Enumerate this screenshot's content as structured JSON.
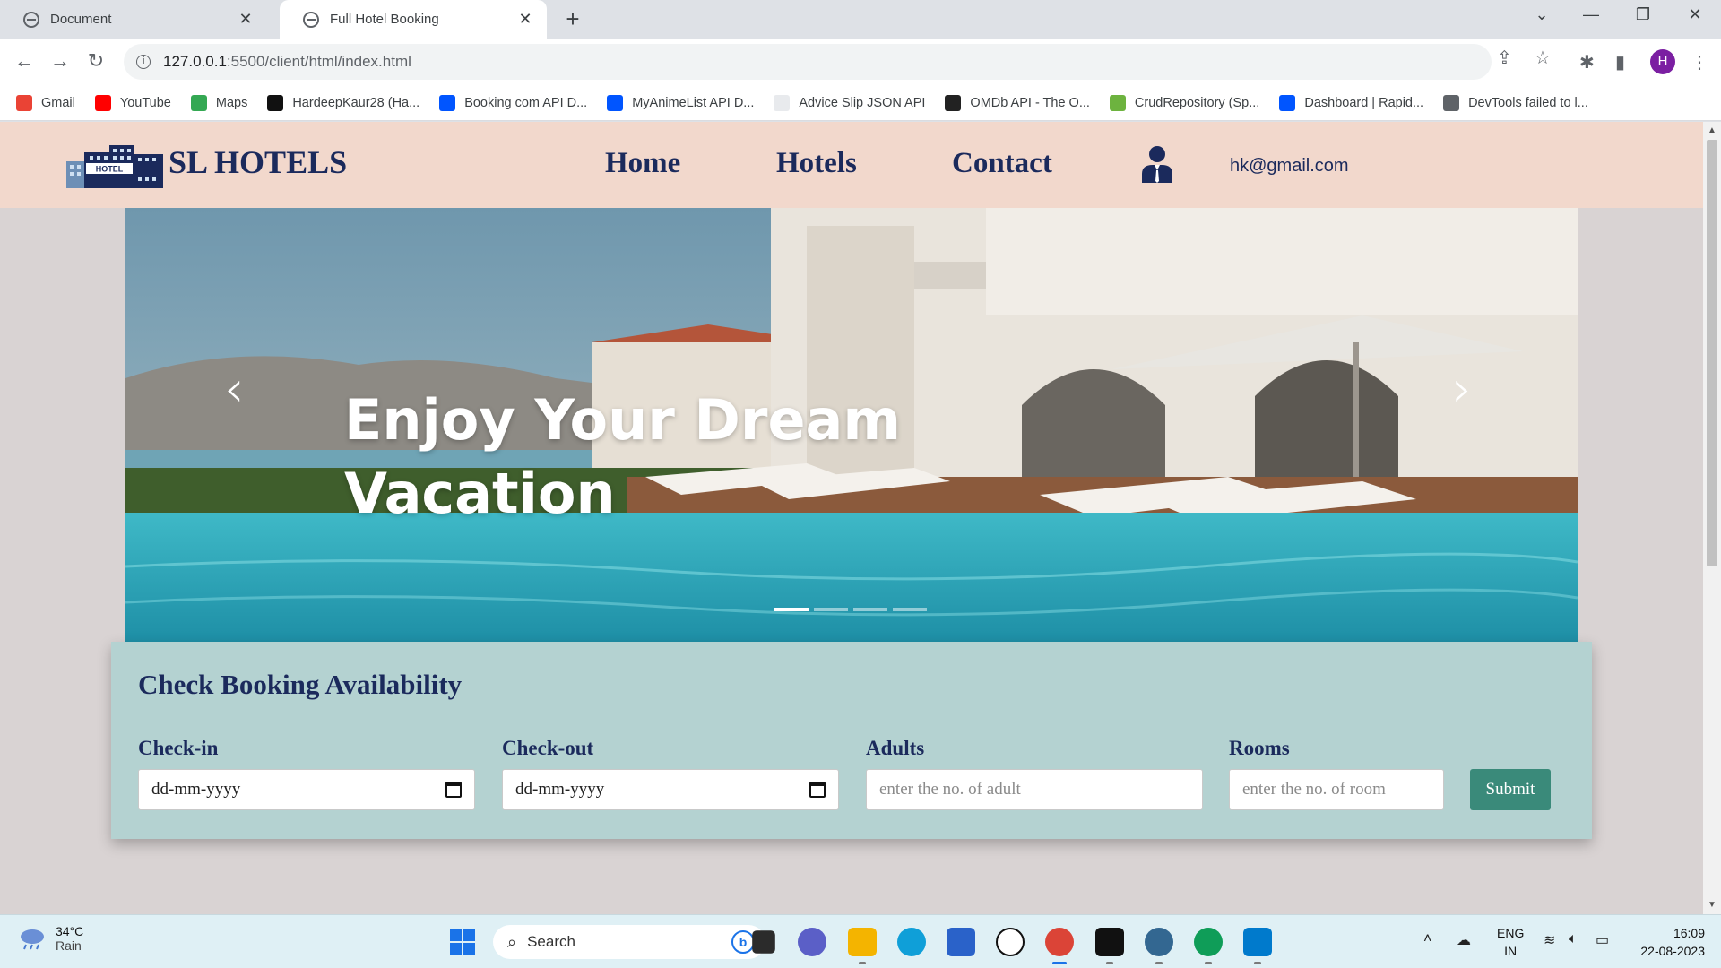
{
  "browser": {
    "tabs": [
      {
        "title": "Document",
        "active": false
      },
      {
        "title": "Full Hotel Booking",
        "active": true
      }
    ],
    "url_host": "127.0.0.1",
    "url_path": ":5500/client/html/index.html",
    "profile_initial": "H",
    "bookmarks": [
      {
        "label": "Gmail",
        "icon": "gmail-icon",
        "color": "#ea4335"
      },
      {
        "label": "YouTube",
        "icon": "youtube-icon",
        "color": "#ff0000"
      },
      {
        "label": "Maps",
        "icon": "maps-icon",
        "color": "#34a853"
      },
      {
        "label": "HardeepKaur28 (Ha...",
        "icon": "github-icon",
        "color": "#111111"
      },
      {
        "label": "Booking com API D...",
        "icon": "rapidapi-icon",
        "color": "#0055ff"
      },
      {
        "label": "MyAnimeList API D...",
        "icon": "rapidapi-icon",
        "color": "#0055ff"
      },
      {
        "label": "Advice Slip JSON API",
        "icon": "page-icon",
        "color": "#e8eaed"
      },
      {
        "label": "OMDb API - The O...",
        "icon": "omdb-icon",
        "color": "#222222"
      },
      {
        "label": "CrudRepository (Sp...",
        "icon": "spring-icon",
        "color": "#6db33f"
      },
      {
        "label": "Dashboard | Rapid...",
        "icon": "rapidapi-icon",
        "color": "#0055ff"
      },
      {
        "label": "DevTools failed to l...",
        "icon": "devtools-icon",
        "color": "#5f6368"
      }
    ]
  },
  "site": {
    "brand": "SL HOTELS",
    "logo_text": "HOTEL",
    "nav": [
      "Home",
      "Hotels",
      "Contact"
    ],
    "user_email": "hk@gmail.com",
    "hero": {
      "title": "Enjoy Your Dream Vacation",
      "slide_count": 4,
      "active_slide": 1
    },
    "booking": {
      "heading": "Check Booking Availability",
      "checkin_label": "Check-in",
      "checkin_value": "dd-mm-yyyy",
      "checkout_label": "Check-out",
      "checkout_value": "dd-mm-yyyy",
      "adults_label": "Adults",
      "adults_placeholder": "enter the no. of adult",
      "rooms_label": "Rooms",
      "rooms_placeholder": "enter the no. of room",
      "submit_label": "Submit"
    }
  },
  "taskbar": {
    "temperature": "34°C",
    "condition": "Rain",
    "search_placeholder": "Search",
    "lang_top": "ENG",
    "lang_bottom": "IN",
    "time": "16:09",
    "date": "22-08-2023"
  },
  "colors": {
    "header_bg": "#f2d8cc",
    "navy": "#1b2a5c",
    "booking_bg": "#b4d2d1",
    "submit_bg": "#3a8a7a"
  }
}
